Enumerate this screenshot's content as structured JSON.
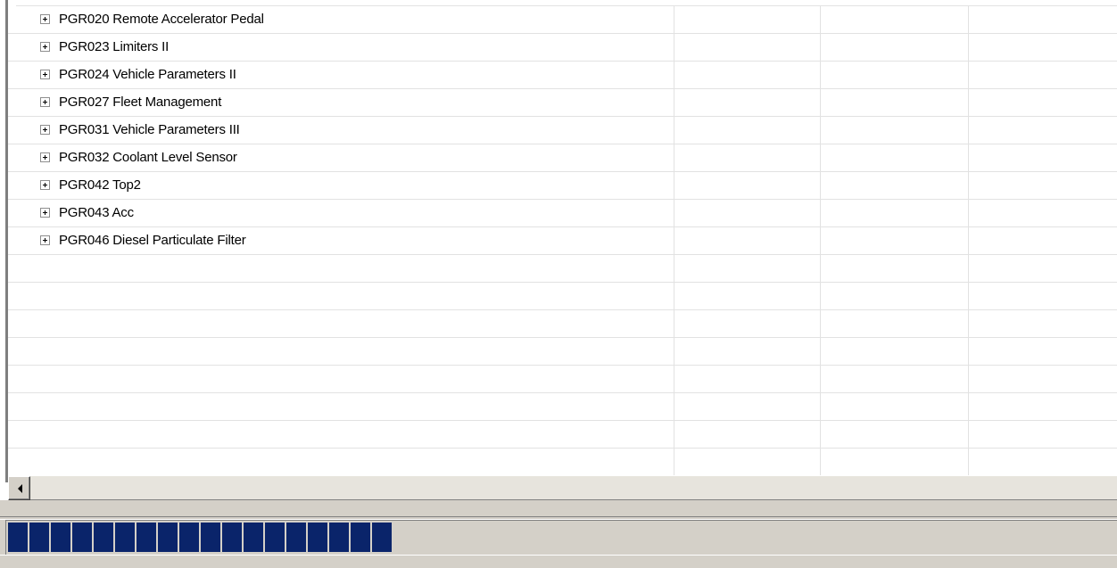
{
  "tree": {
    "rows": [
      {
        "label": "PGR020 Remote Accelerator Pedal",
        "expandable": true
      },
      {
        "label": "PGR023 Limiters II",
        "expandable": true
      },
      {
        "label": "PGR024 Vehicle Parameters II",
        "expandable": true
      },
      {
        "label": "PGR027 Fleet Management",
        "expandable": true
      },
      {
        "label": "PGR031 Vehicle Parameters III",
        "expandable": true
      },
      {
        "label": "PGR032 Coolant Level Sensor",
        "expandable": true
      },
      {
        "label": "PGR042 Top2",
        "expandable": true
      },
      {
        "label": "PGR043 Acc",
        "expandable": true
      },
      {
        "label": "PGR046 Diesel Particulate Filter",
        "expandable": true
      }
    ],
    "empty_rows": 8
  },
  "icons": {
    "expand": "plus-box-icon",
    "scroll_left": "arrow-left-icon"
  },
  "progress": {
    "fraction": 0.37,
    "blocks_filled": 18,
    "color": "#0a246a"
  }
}
